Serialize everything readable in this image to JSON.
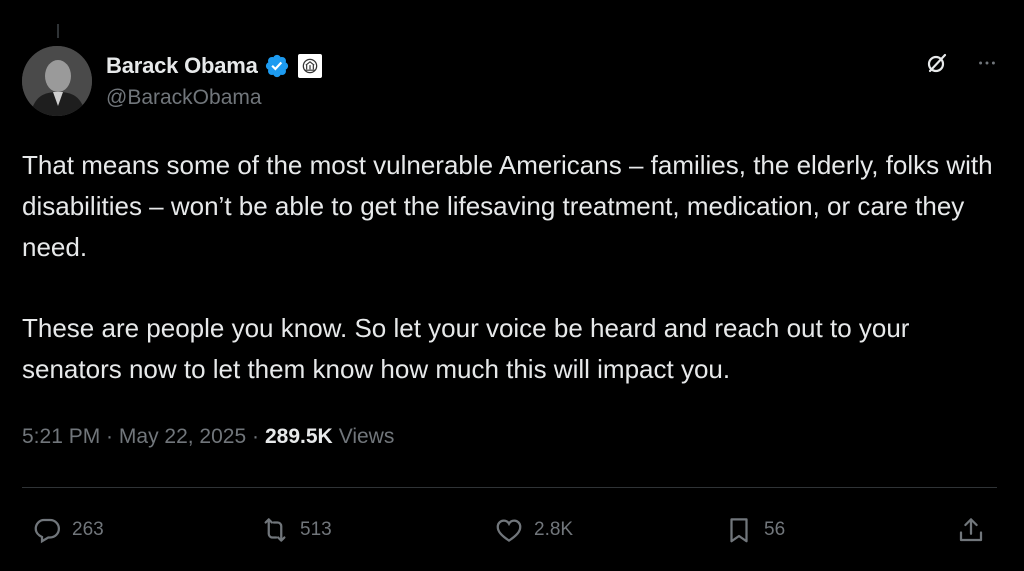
{
  "author": {
    "display_name": "Barack Obama",
    "handle": "@BarackObama"
  },
  "post": {
    "paragraphs": [
      "That means some of the most vulnerable Americans – families, the elderly, folks with disabilities – won’t be able to get the lifesaving treatment, medication, or care they need.",
      "These are people you know. So let your voice be heard and reach out to your senators now to let them know how much this will impact you."
    ],
    "time": "5:21 PM",
    "date": "May 22, 2025",
    "views_count": "289.5K",
    "views_label": "Views"
  },
  "engagement": {
    "replies": "263",
    "reposts": "513",
    "likes": "2.8K",
    "bookmarks": "56"
  },
  "colors": {
    "background": "#000000",
    "text": "#e7e9ea",
    "muted": "#71767b",
    "verified": "#1d9bf0"
  },
  "icons": {
    "verified": "verified-badge-icon",
    "affiliate": "government-seal-icon",
    "grok": "grok-icon",
    "more": "more-dots-icon",
    "reply": "reply-icon",
    "repost": "repost-icon",
    "like": "heart-icon",
    "bookmark": "bookmark-icon",
    "share": "share-icon"
  }
}
